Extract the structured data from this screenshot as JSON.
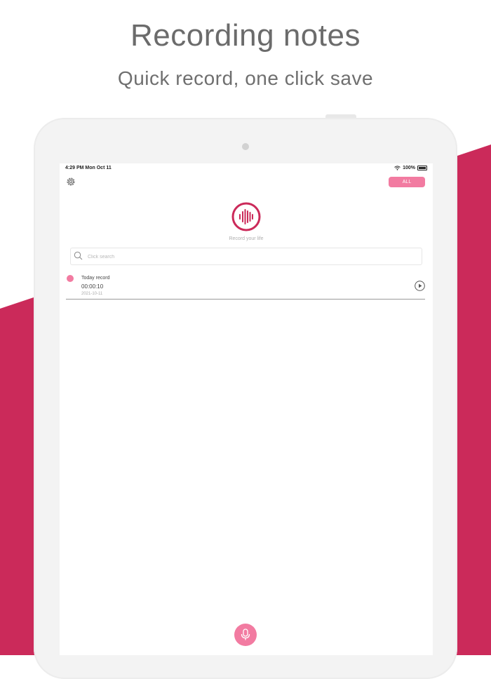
{
  "hero": {
    "title": "Recording notes",
    "subtitle": "Quick record, one click save"
  },
  "colors": {
    "accent_band": "#cb2a5a",
    "accent_pink": "#f27ba1",
    "logo_ring": "#cb2a5a"
  },
  "status_bar": {
    "time": "4:29 PM   Mon Oct 11",
    "battery": "100%"
  },
  "header": {
    "settings_icon": "gear-icon",
    "filter_label": "ALL"
  },
  "brand": {
    "logo_icon": "sound-wave-icon",
    "tagline": "Record your life"
  },
  "search": {
    "placeholder": "Click search",
    "value": ""
  },
  "records": [
    {
      "title": "Today record",
      "duration": "00:00:10",
      "date": "2021-10-11",
      "action_icon": "play-icon"
    }
  ],
  "footer": {
    "record_icon": "microphone-icon"
  }
}
